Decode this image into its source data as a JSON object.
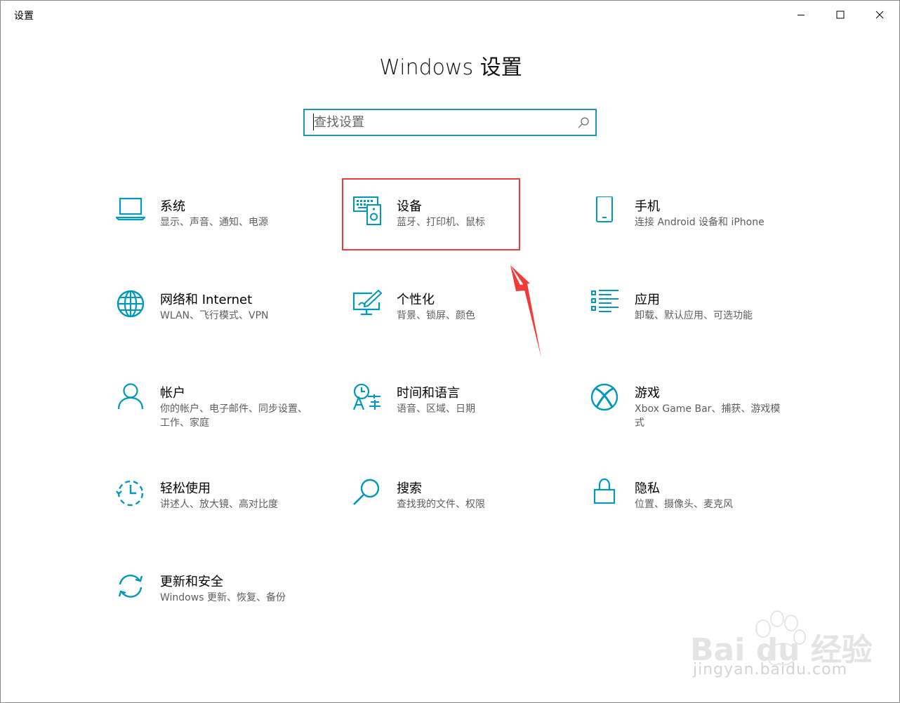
{
  "window": {
    "title": "设置"
  },
  "main": {
    "heading": "Windows 设置",
    "search": {
      "placeholder": "查找设置",
      "value": ""
    },
    "tiles": [
      {
        "title": "系统",
        "desc": "显示、声音、通知、电源",
        "icon": "laptop-icon"
      },
      {
        "title": "设备",
        "desc": "蓝牙、打印机、鼠标",
        "icon": "devices-icon"
      },
      {
        "title": "手机",
        "desc": "连接 Android 设备和 iPhone",
        "icon": "phone-icon"
      },
      {
        "title": "网络和 Internet",
        "desc": "WLAN、飞行模式、VPN",
        "icon": "globe-icon"
      },
      {
        "title": "个性化",
        "desc": "背景、锁屏、颜色",
        "icon": "personalization-icon"
      },
      {
        "title": "应用",
        "desc": "卸载、默认应用、可选功能",
        "icon": "apps-list-icon"
      },
      {
        "title": "帐户",
        "desc": "你的帐户、电子邮件、同步设置、工作、家庭",
        "icon": "person-icon"
      },
      {
        "title": "时间和语言",
        "desc": "语音、区域、日期",
        "icon": "time-language-icon"
      },
      {
        "title": "游戏",
        "desc": "Xbox Game Bar、捕获、游戏模式",
        "icon": "xbox-icon"
      },
      {
        "title": "轻松使用",
        "desc": "讲述人、放大镜、高对比度",
        "icon": "ease-of-access-icon"
      },
      {
        "title": "搜索",
        "desc": "查找我的文件、权限",
        "icon": "search-magnifier-icon"
      },
      {
        "title": "隐私",
        "desc": "位置、摄像头、麦克风",
        "icon": "lock-icon"
      },
      {
        "title": "更新和安全",
        "desc": "Windows 更新、恢复、备份",
        "icon": "sync-icon"
      }
    ]
  },
  "colors": {
    "accent": "#0099bc",
    "highlight": "#f23b3b",
    "text_secondary": "#5d5d5d"
  },
  "watermark": {
    "brand": "Bai du 经验",
    "url": "jingyan.baidu.com"
  }
}
